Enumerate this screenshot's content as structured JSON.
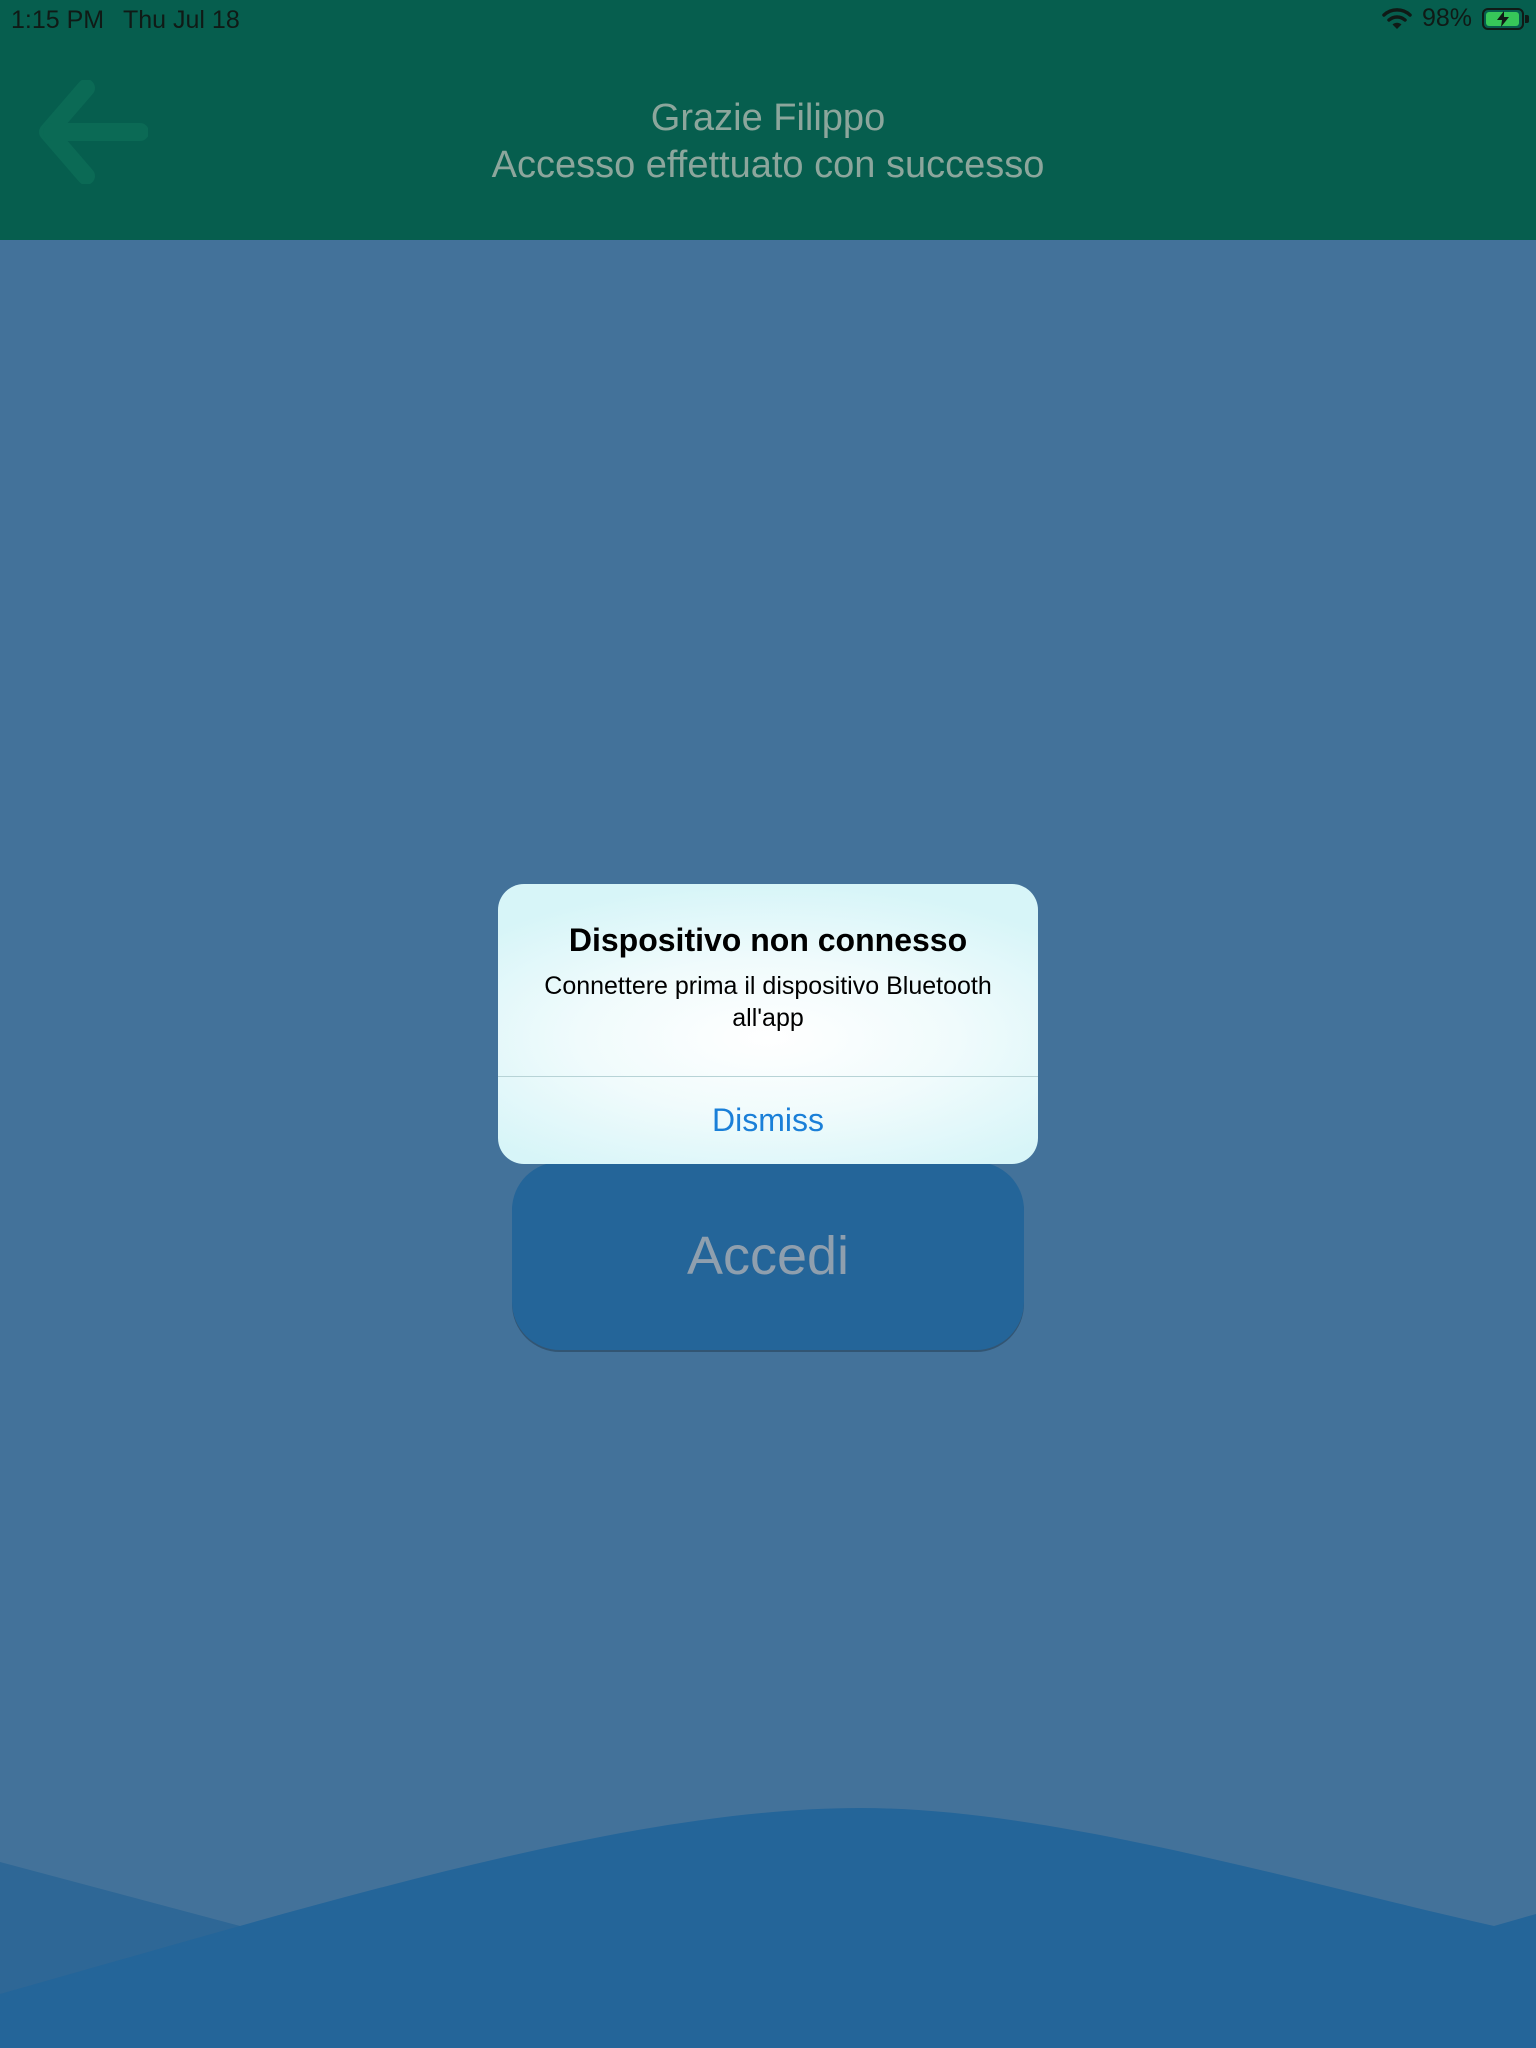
{
  "status_bar": {
    "time": "1:15 PM",
    "date": "Thu Jul 18",
    "battery_percent": "98%",
    "battery_level": 0.98,
    "icons": [
      "wifi-icon",
      "battery-charging-icon"
    ]
  },
  "header": {
    "title": "Grazie Filippo",
    "subtitle": "Accesso effettuato con successo",
    "back_icon": "arrow-left-icon"
  },
  "main": {
    "login_button_label": "Accedi"
  },
  "alert": {
    "title": "Dispositivo non connesso",
    "message": "Connettere prima il dispositivo Bluetooth all'app",
    "dismiss_label": "Dismiss"
  },
  "colors": {
    "header_bg": "#065e4e",
    "page_bg": "#43729a",
    "button_bg": "#246599",
    "alert_action": "#1a7fd8",
    "battery": "#37c759"
  }
}
